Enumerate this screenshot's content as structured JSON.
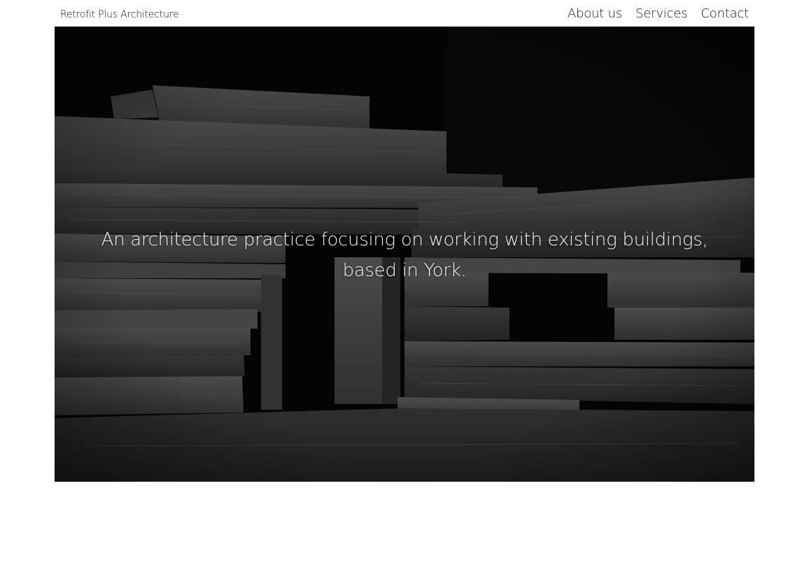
{
  "header": {
    "brand": "Retrofit Plus Architecture",
    "nav": [
      {
        "label": "About us"
      },
      {
        "label": "Services"
      },
      {
        "label": "Contact"
      }
    ]
  },
  "hero": {
    "tagline_line1": "An architecture practice focusing on working with existing buildings,",
    "tagline_line2": "based in York.",
    "image": "black-and-white photo of stacked weathered timber pieces forming a model of a structure"
  },
  "colors": {
    "background": "#ffffff",
    "text": "#111111",
    "hero_text": "#f4f4f4"
  }
}
